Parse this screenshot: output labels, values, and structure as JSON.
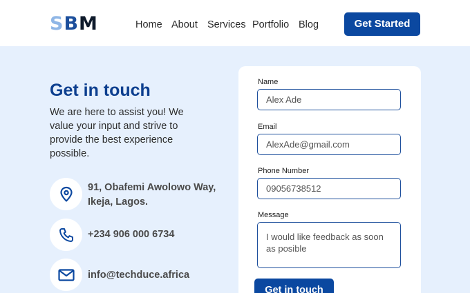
{
  "header": {
    "logo": {
      "l1": "S",
      "l2": "B",
      "l3": "M"
    },
    "nav": [
      "Home",
      "About",
      "Services",
      "Portfolio",
      "Blog"
    ],
    "cta": "Get Started"
  },
  "contact": {
    "title": "Get in touch",
    "description": "We are here to assist you! We value your input and strive to provide the best experience possible.",
    "address": "91, Obafemi Awolowo Way, Ikeja, Lagos.",
    "phone": "+234 906 000 6734",
    "email": "info@techduce.africa",
    "icons": [
      "location-pin-icon",
      "phone-icon",
      "mail-icon"
    ]
  },
  "form": {
    "name_label": "Name",
    "name_value": "Alex Ade",
    "email_label": "Email",
    "email_value": "AlexAde@gmail.com",
    "phone_label": "Phone Number",
    "phone_value": "09056738512",
    "message_label": "Message",
    "message_value": "I would like feedback as soon as posible",
    "submit": "Get in touch"
  },
  "colors": {
    "primary": "#0b48a0",
    "background": "#e6f0fd",
    "title": "#0d3f8f"
  }
}
